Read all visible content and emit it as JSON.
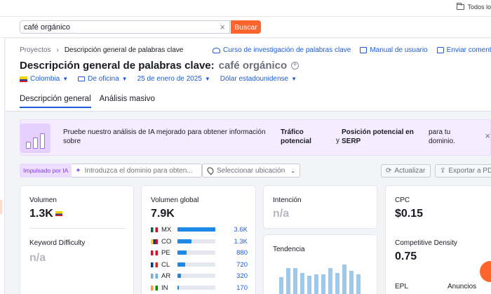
{
  "browser": {
    "bookmark_label": "Todos lo"
  },
  "search": {
    "query": "café orgánico",
    "button_label": "Buscar"
  },
  "breadcrumb": {
    "parent": "Proyectos",
    "current": "Descripción general de palabras clave"
  },
  "header_links": [
    {
      "label": "Curso de investigación de palabras clave",
      "icon": "graduation-cap-icon"
    },
    {
      "label": "Manual de usuario",
      "icon": "book-icon"
    },
    {
      "label": "Enviar comentar",
      "icon": "comment-icon"
    }
  ],
  "page": {
    "title": "Descripción general de palabras clave:",
    "keyword": "café orgánico"
  },
  "filters": {
    "database": "Colombia",
    "device": "De oficina",
    "date": "25 de enero de 2025",
    "currency": "Dólar estadounidense"
  },
  "tabs": [
    {
      "label": "Descripción general",
      "active": true
    },
    {
      "label": "Análisis masivo",
      "active": false
    }
  ],
  "promo": {
    "text": "Pruebe nuestro análisis de IA mejorado para obtener información sobre",
    "strong1": "Tráfico potencial",
    "connector": "y",
    "strong2": "Posición potencial en SERP",
    "tail": "para tu dominio.",
    "close": "×"
  },
  "ai_tools": {
    "badge": "Impulsado por IA",
    "domain_placeholder": "Introduzca el dominio para obten...",
    "location_placeholder": "Seleccionar ubicación",
    "update_label": "Actualizar",
    "export_label": "Exportar a PD"
  },
  "cards": {
    "volume": {
      "label": "Volumen",
      "value": "1.3K"
    },
    "keyword_difficulty": {
      "label": "Keyword Difficulty",
      "value": "n/a"
    },
    "global_volume": {
      "label": "Volumen global",
      "value": "7.9K",
      "countries": [
        {
          "code": "MX",
          "value": "3.6K",
          "share": 0.46,
          "flag_colors": [
            "#006847",
            "#ffffff",
            "#ce1126"
          ]
        },
        {
          "code": "CO",
          "value": "1.3K",
          "share": 0.17,
          "flag_colors": [
            "#fcd116",
            "#003893",
            "#ce1126"
          ]
        },
        {
          "code": "PE",
          "value": "880",
          "share": 0.11,
          "flag_colors": [
            "#d91023",
            "#ffffff",
            "#d91023"
          ]
        },
        {
          "code": "CL",
          "value": "720",
          "share": 0.09,
          "flag_colors": [
            "#0039a6",
            "#ffffff",
            "#d52b1e"
          ]
        },
        {
          "code": "AR",
          "value": "320",
          "share": 0.04,
          "flag_colors": [
            "#74acdf",
            "#ffffff",
            "#74acdf"
          ]
        },
        {
          "code": "IN",
          "value": "170",
          "share": 0.02,
          "flag_colors": [
            "#ff9933",
            "#ffffff",
            "#138808"
          ]
        }
      ]
    },
    "intent": {
      "label": "Intención",
      "value": "n/a"
    },
    "trend": {
      "label": "Tendencia",
      "values": [
        0.55,
        0.85,
        0.85,
        0.7,
        0.6,
        0.65,
        0.65,
        0.85,
        0.7,
        0.95,
        0.75,
        0.65
      ]
    },
    "cpc": {
      "label": "CPC",
      "value": "$0.15"
    },
    "competitive_density": {
      "label": "Competitive Density",
      "value": "0.75"
    },
    "epl_label": "EPL",
    "ads_label": "Anuncios"
  }
}
